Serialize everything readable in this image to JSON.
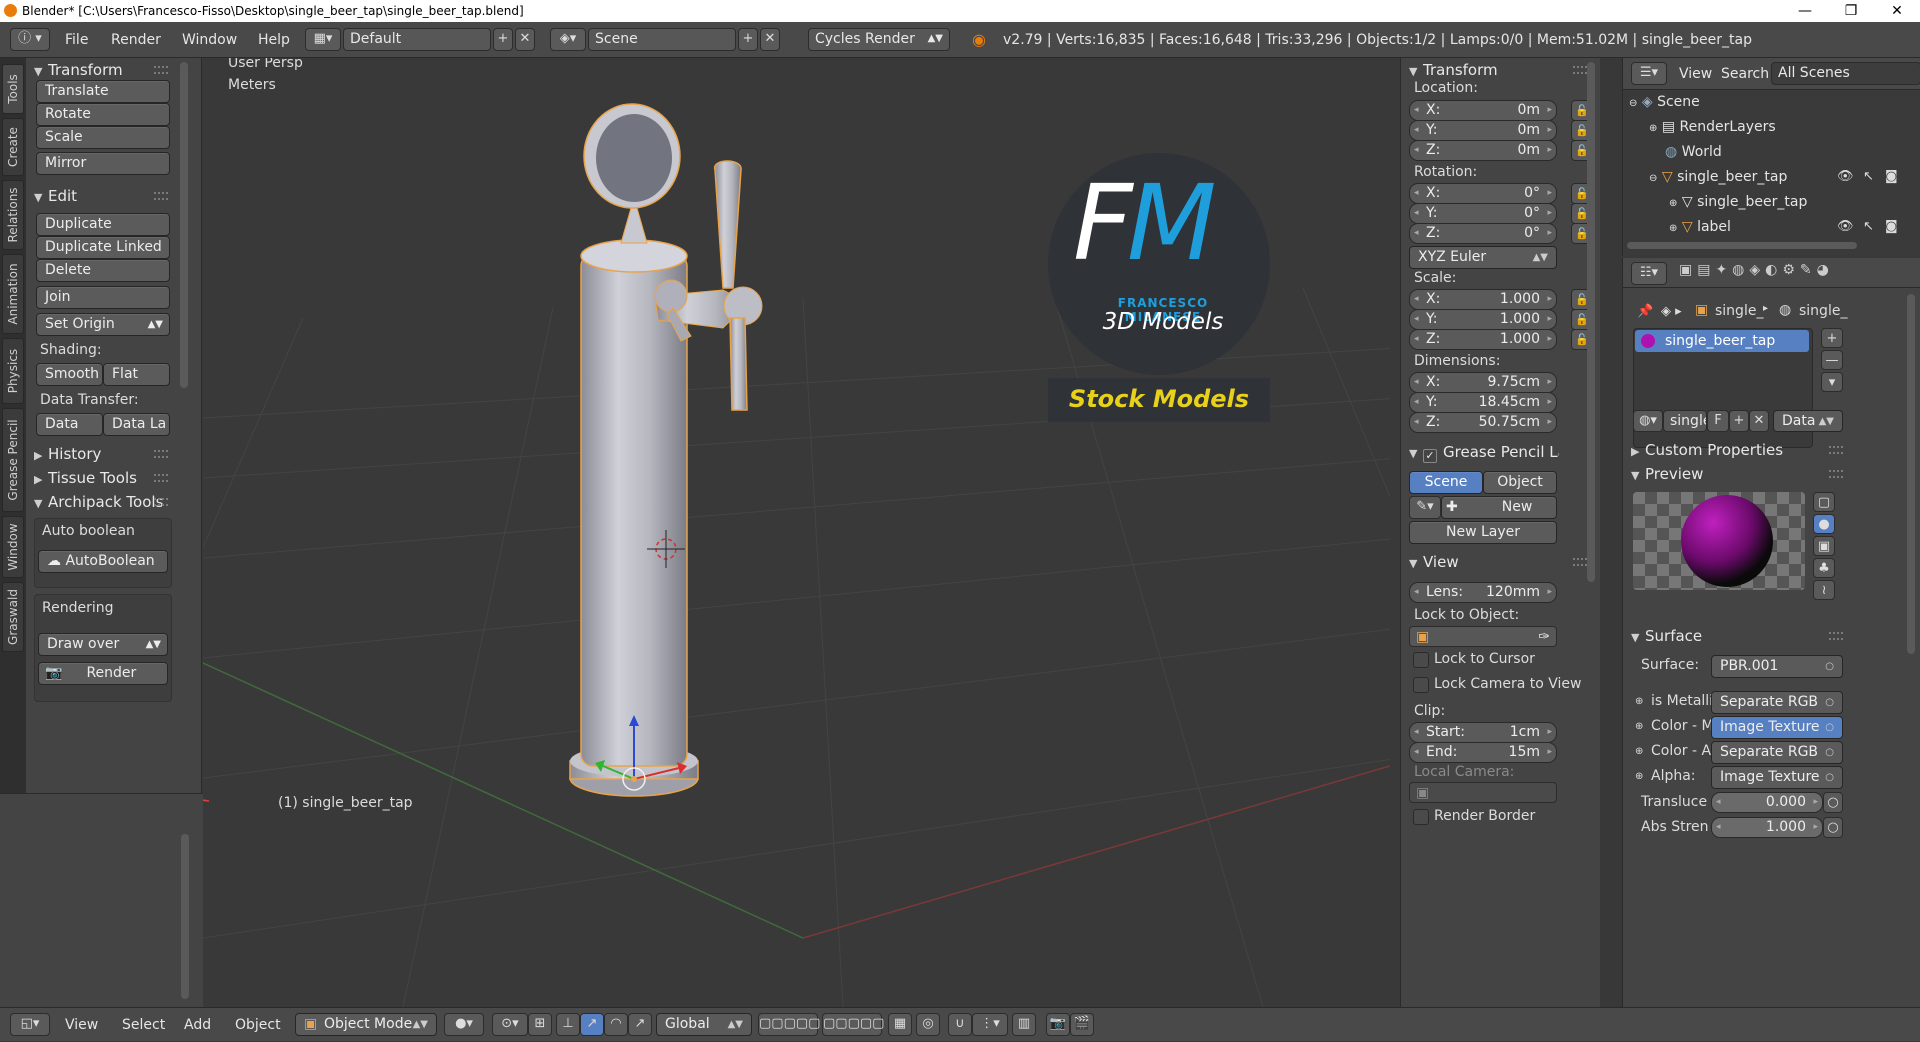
{
  "window": {
    "title": "Blender* [C:\\Users\\Francesco-Fisso\\Desktop\\single_beer_tap\\single_beer_tap.blend]",
    "minimize": "—",
    "maximize": "❐",
    "close": "✕"
  },
  "info_bar": {
    "menus": [
      "File",
      "Render",
      "Window",
      "Help"
    ],
    "layout": "Default",
    "scene": "Scene",
    "engine": "Cycles Render",
    "stats": "v2.79 | Verts:16,835 | Faces:16,648 | Tris:33,296 | Objects:1/2 | Lamps:0/0 | Mem:51.02M | single_beer_tap"
  },
  "tool_tabs": [
    "Tools",
    "Create",
    "Relations",
    "Animation",
    "Physics",
    "Grease Pencil",
    "Window",
    "Graswald"
  ],
  "tool_shelf": {
    "transform": {
      "title": "Transform",
      "buttons": [
        "Translate",
        "Rotate",
        "Scale",
        "Mirror"
      ]
    },
    "edit": {
      "title": "Edit",
      "buttons": [
        "Duplicate",
        "Duplicate Linked",
        "Delete",
        "Join"
      ],
      "set_origin": "Set Origin",
      "shading_label": "Shading:",
      "smooth": "Smooth",
      "flat": "Flat",
      "data_transfer_label": "Data Transfer:",
      "data": "Data",
      "data_la": "Data La"
    },
    "history": "History",
    "tissue": "Tissue Tools",
    "archipack": {
      "title": "Archipack Tools",
      "auto_boolean_label": "Auto boolean",
      "auto_boolean_btn": "AutoBoolean",
      "rendering_label": "Rendering",
      "draw_over": "Draw over",
      "render": "Render"
    }
  },
  "viewport": {
    "view_name": "User Persp",
    "units": "Meters",
    "object_label": "(1) single_beer_tap",
    "logo": {
      "letters": "FM",
      "name": "FRANCESCO MILANESE",
      "tagline": "3D Models",
      "banner": "Stock Models"
    },
    "colors": {
      "logo_bg": "#2f3236",
      "logo_blue": "#1e9fdc",
      "banner_text": "#e8d11a",
      "model": "#b9b9c2",
      "outline": "#e8a34a"
    }
  },
  "n_panel": {
    "transform_title": "Transform",
    "location_label": "Location:",
    "location": {
      "x": "0m",
      "y": "0m",
      "z": "0m"
    },
    "rotation_label": "Rotation:",
    "rotation": {
      "x": "0°",
      "y": "0°",
      "z": "0°"
    },
    "rotation_mode": "XYZ Euler",
    "scale_label": "Scale:",
    "scale": {
      "x": "1.000",
      "y": "1.000",
      "z": "1.000"
    },
    "dimensions_label": "Dimensions:",
    "dimensions": {
      "x": "9.75cm",
      "y": "18.45cm",
      "z": "50.75cm"
    },
    "axis": {
      "x": "X:",
      "y": "Y:",
      "z": "Z:"
    },
    "grease_title": "Grease Pencil Layer",
    "scene_tab": "Scene",
    "object_tab": "Object",
    "new": "New",
    "new_layer": "New Layer",
    "view_title": "View",
    "lens_label": "Lens:",
    "lens": "120mm",
    "lock_to_object": "Lock to Object:",
    "lock_to_cursor": "Lock to Cursor",
    "lock_camera": "Lock Camera to View",
    "clip_label": "Clip:",
    "clip_start_label": "Start:",
    "clip_start": "1cm",
    "clip_end_label": "End:",
    "clip_end": "15m",
    "local_camera": "Local Camera:",
    "render_border": "Render Border"
  },
  "outliner": {
    "view": "View",
    "search": "Search",
    "filter": "All Scenes",
    "items": [
      {
        "label": "Scene"
      },
      {
        "label": "RenderLayers"
      },
      {
        "label": "World"
      },
      {
        "label": "single_beer_tap"
      },
      {
        "label": "single_beer_tap"
      },
      {
        "label": "label"
      }
    ]
  },
  "properties": {
    "breadcrumb": [
      "single_",
      "single_"
    ],
    "material_slot": "single_beer_tap",
    "material_name": "single",
    "fake_user": "F",
    "link": "Data",
    "custom_properties": "Custom Properties",
    "preview": "Preview",
    "surface_title": "Surface",
    "surface_label": "Surface:",
    "surface_value": "PBR.001",
    "inputs": [
      {
        "label": "is Metallic",
        "value": "Separate RGB"
      },
      {
        "label": "Color - Ma",
        "value": "Image Texture"
      },
      {
        "label": "Color - Ab",
        "value": "Separate RGB"
      },
      {
        "label": "Alpha:",
        "value": "Image Texture"
      }
    ],
    "translucent_label": "Transluce",
    "translucent": "0.000",
    "abs_label": "Abs Stren",
    "abs": "1.000"
  },
  "bottom_bar": {
    "menus": [
      "View",
      "Select",
      "Add",
      "Object"
    ],
    "mode": "Object Mode",
    "orientation": "Global"
  }
}
